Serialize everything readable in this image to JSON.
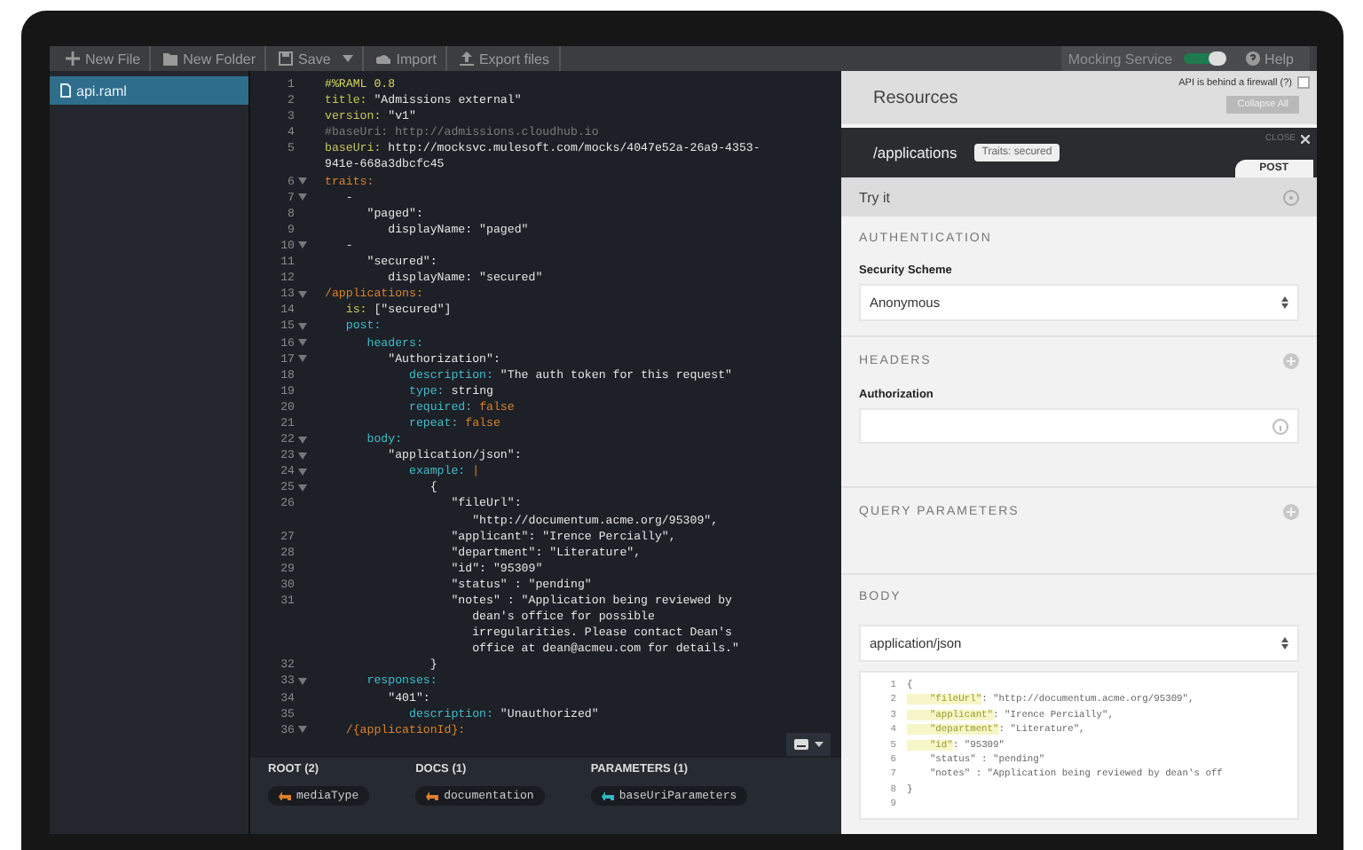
{
  "toolbar": {
    "buttons": [
      {
        "kind": "newfile",
        "label": "New File",
        "menu": false
      },
      {
        "kind": "folder",
        "label": "New Folder",
        "menu": false
      },
      {
        "kind": "save",
        "label": "Save",
        "menu": true
      },
      {
        "kind": "import",
        "label": "Import",
        "menu": false
      },
      {
        "kind": "export",
        "label": "Export files",
        "menu": false
      }
    ],
    "mocking": {
      "label": "Mocking Service",
      "on": true
    },
    "help": "Help"
  },
  "sidebar": {
    "items": [
      {
        "label": "api.raml",
        "selected": true
      }
    ]
  },
  "editor": {
    "lines": [
      {
        "number": "1",
        "foldable": false,
        "segments": [
          {
            "kind": "head",
            "text": "#%RAML 0.8"
          }
        ]
      },
      {
        "number": "2",
        "foldable": false,
        "segments": [
          {
            "kind": "key",
            "text": "title:"
          },
          {
            "kind": "str",
            "text": " \"Admissions external\""
          }
        ]
      },
      {
        "number": "3",
        "foldable": false,
        "segments": [
          {
            "kind": "key",
            "text": "version:"
          },
          {
            "kind": "str",
            "text": " \"v1\""
          }
        ]
      },
      {
        "number": "4",
        "foldable": false,
        "segments": [
          {
            "kind": "comment",
            "text": "#baseUri: http://admissions.cloudhub.io"
          }
        ]
      },
      {
        "number": "5",
        "foldable": false,
        "segments": [
          {
            "kind": "key",
            "text": "baseUri:"
          },
          {
            "kind": "str",
            "text": " http://mocksvc.mulesoft.com/mocks/4047e52a-26a9-4353-"
          }
        ]
      },
      {
        "foldable": false,
        "segments": [
          {
            "kind": "str",
            "text": "941e-668a3dbcfc45"
          }
        ]
      },
      {
        "number": "6",
        "foldable": true,
        "segments": [
          {
            "kind": "path",
            "text": "traits:"
          }
        ]
      },
      {
        "number": "7",
        "foldable": true,
        "segments": [
          {
            "kind": "str",
            "text": "   -"
          }
        ]
      },
      {
        "number": "8",
        "foldable": false,
        "segments": [
          {
            "kind": "str",
            "text": "      \"paged\":"
          }
        ]
      },
      {
        "number": "9",
        "foldable": false,
        "segments": [
          {
            "kind": "str",
            "text": "         displayName: \"paged\""
          }
        ]
      },
      {
        "number": "10",
        "foldable": true,
        "segments": [
          {
            "kind": "str",
            "text": "   -"
          }
        ]
      },
      {
        "number": "11",
        "foldable": false,
        "segments": [
          {
            "kind": "str",
            "text": "      \"secured\":"
          }
        ]
      },
      {
        "number": "12",
        "foldable": false,
        "segments": [
          {
            "kind": "str",
            "text": "         displayName: \"secured\""
          }
        ]
      },
      {
        "number": "13",
        "foldable": true,
        "segments": [
          {
            "kind": "path",
            "text": "/applications:"
          }
        ]
      },
      {
        "number": "14",
        "foldable": false,
        "segments": [
          {
            "kind": "key",
            "text": "   is:"
          },
          {
            "kind": "str",
            "text": " [\"secured\"]"
          }
        ]
      },
      {
        "number": "15",
        "foldable": true,
        "segments": [
          {
            "kind": "key2",
            "text": "   post:"
          }
        ]
      },
      {
        "number": "16",
        "foldable": true,
        "segments": [
          {
            "kind": "key2",
            "text": "      headers:"
          }
        ]
      },
      {
        "number": "17",
        "foldable": true,
        "segments": [
          {
            "kind": "str",
            "text": "         \"Authorization\":"
          }
        ]
      },
      {
        "number": "18",
        "foldable": false,
        "segments": [
          {
            "kind": "key2",
            "text": "            description:"
          },
          {
            "kind": "str",
            "text": " \"The auth token for this request\""
          }
        ]
      },
      {
        "number": "19",
        "foldable": false,
        "segments": [
          {
            "kind": "key2",
            "text": "            type:"
          },
          {
            "kind": "str",
            "text": " string"
          }
        ]
      },
      {
        "number": "20",
        "foldable": false,
        "segments": [
          {
            "kind": "key2",
            "text": "            required:"
          },
          {
            "kind": "bool",
            "text": " false"
          }
        ]
      },
      {
        "number": "21",
        "foldable": false,
        "segments": [
          {
            "kind": "key2",
            "text": "            repeat:"
          },
          {
            "kind": "bool",
            "text": " false"
          }
        ]
      },
      {
        "number": "22",
        "foldable": true,
        "segments": [
          {
            "kind": "key2",
            "text": "      body:"
          }
        ]
      },
      {
        "number": "23",
        "foldable": true,
        "segments": [
          {
            "kind": "str",
            "text": "         \"application/json\":"
          }
        ]
      },
      {
        "number": "24",
        "foldable": true,
        "segments": [
          {
            "kind": "key2",
            "text": "            example:"
          },
          {
            "kind": "bool",
            "text": " |"
          }
        ]
      },
      {
        "number": "25",
        "foldable": true,
        "segments": [
          {
            "kind": "str",
            "text": "               {"
          }
        ]
      },
      {
        "number": "26",
        "foldable": false,
        "segments": [
          {
            "kind": "str",
            "text": "                  \"fileUrl\":"
          }
        ]
      },
      {
        "foldable": false,
        "segments": [
          {
            "kind": "str",
            "text": "                     \"http://documentum.acme.org/95309\","
          }
        ]
      },
      {
        "number": "27",
        "foldable": false,
        "segments": [
          {
            "kind": "str",
            "text": "                  \"applicant\": \"Irence Percially\","
          }
        ]
      },
      {
        "number": "28",
        "foldable": false,
        "segments": [
          {
            "kind": "str",
            "text": "                  \"department\": \"Literature\","
          }
        ]
      },
      {
        "number": "29",
        "foldable": false,
        "segments": [
          {
            "kind": "str",
            "text": "                  \"id\": \"95309\""
          }
        ]
      },
      {
        "number": "30",
        "foldable": false,
        "segments": [
          {
            "kind": "str",
            "text": "                  \"status\" : \"pending\""
          }
        ]
      },
      {
        "number": "31",
        "foldable": false,
        "segments": [
          {
            "kind": "str",
            "text": "                  \"notes\" : \"Application being reviewed by"
          }
        ]
      },
      {
        "foldable": false,
        "segments": [
          {
            "kind": "str",
            "text": "                     dean's office for possible"
          }
        ]
      },
      {
        "foldable": false,
        "segments": [
          {
            "kind": "str",
            "text": "                     irregularities. Please contact Dean's"
          }
        ]
      },
      {
        "foldable": false,
        "segments": [
          {
            "kind": "str",
            "text": "                     office at dean@acmeu.com for details.\""
          }
        ]
      },
      {
        "number": "32",
        "foldable": false,
        "segments": [
          {
            "kind": "str",
            "text": "               }"
          }
        ]
      },
      {
        "number": "33",
        "foldable": true,
        "segments": [
          {
            "kind": "key2",
            "text": "      responses:"
          }
        ]
      },
      {
        "number": "34",
        "foldable": false,
        "segments": [
          {
            "kind": "str",
            "text": "         \"401\":"
          }
        ]
      },
      {
        "number": "35",
        "foldable": false,
        "segments": [
          {
            "kind": "key2",
            "text": "            description:"
          },
          {
            "kind": "str",
            "text": " \"Unauthorized\""
          }
        ]
      },
      {
        "number": "36",
        "foldable": true,
        "segments": [
          {
            "kind": "path",
            "text": "   /{applicationId}:"
          }
        ]
      }
    ],
    "shelf": [
      {
        "heading": "ROOT (2)",
        "items": [
          {
            "label": "mediaType",
            "color": "#d9822b"
          }
        ]
      },
      {
        "heading": "DOCS (1)",
        "items": [
          {
            "label": "documentation",
            "color": "#d9822b"
          }
        ]
      },
      {
        "heading": "PARAMETERS (1)",
        "items": [
          {
            "label": "baseUriParameters",
            "color": "#3bb3c3"
          }
        ]
      }
    ]
  },
  "console": {
    "title": "Resources",
    "firewall": {
      "label": "API is behind a firewall (?)",
      "checked": false
    },
    "collapse": "Collapse All",
    "resource": {
      "path": "/applications",
      "badge": "Traits: secured",
      "close": "CLOSE",
      "methods": [
        {
          "label": "POST",
          "selected": true
        }
      ]
    },
    "try_it": "Try it",
    "sections": [
      {
        "kind": "auth",
        "heading": "AUTHENTICATION",
        "label": "Security Scheme",
        "value": "Anonymous"
      },
      {
        "kind": "headers",
        "heading": "HEADERS",
        "label": "Authorization"
      },
      {
        "kind": "query",
        "heading": "QUERY PARAMETERS"
      },
      {
        "kind": "body",
        "heading": "BODY",
        "value": "application/json",
        "code": [
          {
            "number": "1",
            "text": "{"
          },
          {
            "number": "2",
            "key": "    \"fileUrl\"",
            "text": ": \"http://documentum.acme.org/95309\","
          },
          {
            "number": "3",
            "key": "    \"applicant\"",
            "text": ": \"Irence Percially\","
          },
          {
            "number": "4",
            "key": "    \"department\"",
            "text": ": \"Literature\","
          },
          {
            "number": "5",
            "key": "    \"id\"",
            "text": ": \"95309\""
          },
          {
            "number": "6",
            "text": "    \"status\" : \"pending\""
          },
          {
            "number": "7",
            "text": "    \"notes\" : \"Application being reviewed by dean's off"
          },
          {
            "number": "8",
            "text": "}"
          },
          {
            "number": "9"
          }
        ]
      }
    ]
  }
}
